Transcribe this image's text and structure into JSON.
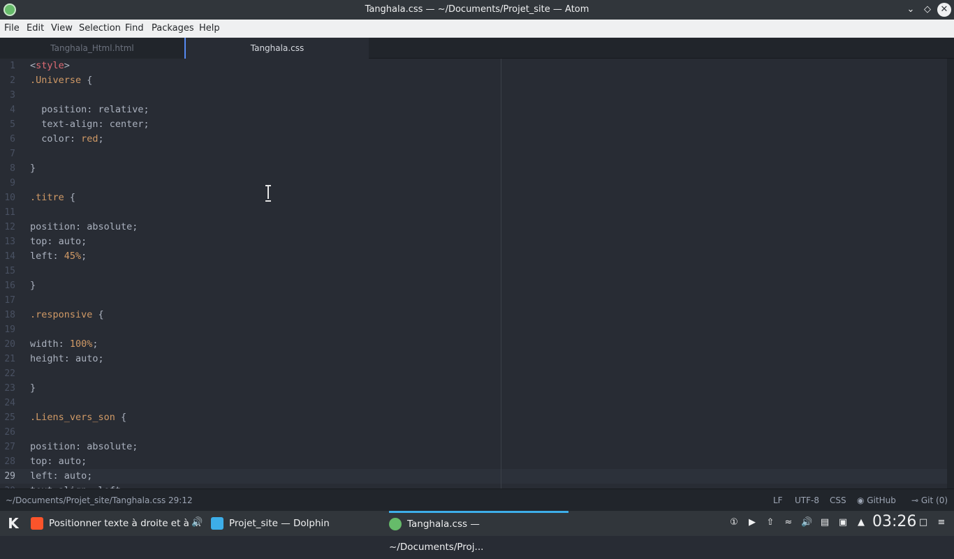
{
  "window": {
    "title": "Tanghala.css — ~/Documents/Projet_site — Atom"
  },
  "menu": [
    "File",
    "Edit",
    "View",
    "Selection",
    "Find",
    "Packages",
    "Help"
  ],
  "tabs": [
    {
      "label": "Tanghala_Html.html",
      "active": false
    },
    {
      "label": "Tanghala.css",
      "active": true
    }
  ],
  "editor": {
    "active_line": 29,
    "lines": [
      [
        {
          "t": "<",
          "c": "punct"
        },
        {
          "t": "style",
          "c": "tag"
        },
        {
          "t": ">",
          "c": "punct"
        }
      ],
      [
        {
          "t": ".Universe",
          "c": "sel"
        },
        {
          "t": " {",
          "c": "punct"
        }
      ],
      [],
      [
        {
          "t": "  position: relative;",
          "c": "punct"
        }
      ],
      [
        {
          "t": "  text-align: center;",
          "c": "punct"
        }
      ],
      [
        {
          "t": "  color: ",
          "c": "punct"
        },
        {
          "t": "red",
          "c": "val"
        },
        {
          "t": ";",
          "c": "punct"
        }
      ],
      [],
      [
        {
          "t": "}",
          "c": "punct"
        }
      ],
      [],
      [
        {
          "t": ".titre",
          "c": "sel"
        },
        {
          "t": " {",
          "c": "punct"
        }
      ],
      [],
      [
        {
          "t": "position: absolute;",
          "c": "punct"
        }
      ],
      [
        {
          "t": "top: auto;",
          "c": "punct"
        }
      ],
      [
        {
          "t": "left: ",
          "c": "punct"
        },
        {
          "t": "45%",
          "c": "val"
        },
        {
          "t": ";",
          "c": "punct"
        }
      ],
      [],
      [
        {
          "t": "}",
          "c": "punct"
        }
      ],
      [],
      [
        {
          "t": ".responsive",
          "c": "sel"
        },
        {
          "t": " {",
          "c": "punct"
        }
      ],
      [],
      [
        {
          "t": "width: ",
          "c": "punct"
        },
        {
          "t": "100%",
          "c": "val"
        },
        {
          "t": ";",
          "c": "punct"
        }
      ],
      [
        {
          "t": "height: auto;",
          "c": "punct"
        }
      ],
      [],
      [
        {
          "t": "}",
          "c": "punct"
        }
      ],
      [],
      [
        {
          "t": ".Liens_vers_son",
          "c": "sel"
        },
        {
          "t": " {",
          "c": "punct"
        }
      ],
      [],
      [
        {
          "t": "position: absolute;",
          "c": "punct"
        }
      ],
      [
        {
          "t": "top: auto;",
          "c": "punct"
        }
      ],
      [
        {
          "t": "left: auto;",
          "c": "punct"
        }
      ],
      [
        {
          "t": "text-align: left;",
          "c": "punct"
        }
      ]
    ]
  },
  "status": {
    "path": "~/Documents/Projet_site/Tanghala.css",
    "position": "29:12",
    "line_ending": "LF",
    "encoding": "UTF-8",
    "grammar": "CSS",
    "github": "GitHub",
    "git": "Git (0)"
  },
  "taskbar": {
    "tasks": [
      {
        "label": "Positionner texte à droite et à ...",
        "icon": "brave-browser-icon",
        "color": "#fb542b"
      },
      {
        "label": "Projet_site — Dolphin",
        "icon": "folder-icon",
        "color": "#3daee9"
      },
      {
        "label": "Tanghala.css — ~/Documents/Proj...",
        "icon": "atom-icon",
        "color": "#66bb6a"
      }
    ],
    "clock": "03:26"
  }
}
